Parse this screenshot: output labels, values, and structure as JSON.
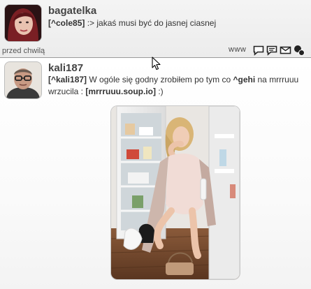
{
  "posts": [
    {
      "username": "bagatelka",
      "mention": "[^cole85]",
      "text": ":> jakaś musi być do jasnej ciasnej",
      "time": "przed chwilą",
      "www": "www",
      "actions": [
        "comment-icon",
        "quote-icon",
        "mail-icon",
        "profile-icon"
      ]
    },
    {
      "username": "kali187",
      "mention": "[^kali187]",
      "text_part1": " W ogóle się godny zrobiłem po tym co ",
      "mention2": "^gehi",
      "text_part2": " na mrrruuu wrzucila : ",
      "link": "[mrrruuu.soup.io]",
      "text_part3": " :)"
    }
  ],
  "colors": {
    "divider": "#9a9a9a",
    "icon": "#222222"
  }
}
